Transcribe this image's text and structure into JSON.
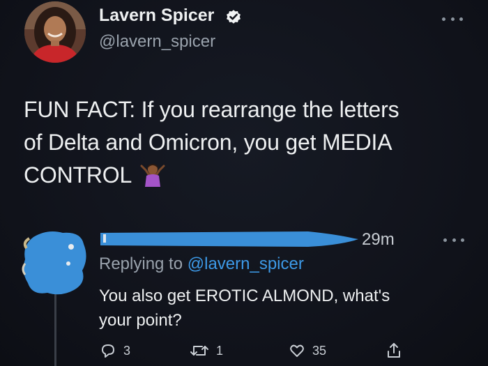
{
  "tweet": {
    "author_name": "Lavern Spicer",
    "author_handle": "@lavern_spicer",
    "verified": true,
    "text_lines": [
      "FUN FACT: If you rearrange the letters",
      "of Delta and Omicron, you get MEDIA",
      "CONTROL"
    ],
    "emoji": "person-shrugging-emoji"
  },
  "reply": {
    "time": "29m",
    "replying_prefix": "Replying to",
    "replying_handle": "@lavern_spicer",
    "text_lines": [
      "You also get EROTIC ALMOND, what's",
      "your point?"
    ],
    "actions": {
      "reply_count": "3",
      "retweet_count": "1",
      "like_count": "35"
    }
  },
  "colors": {
    "background": "#12141c",
    "text": "#eef0f1",
    "muted": "#9aa3ad",
    "link": "#3d9ae8",
    "redaction": "#3a8fd8"
  },
  "icons": [
    "verified-badge-icon",
    "more-options-icon",
    "reply-icon",
    "retweet-icon",
    "like-icon",
    "share-icon"
  ]
}
